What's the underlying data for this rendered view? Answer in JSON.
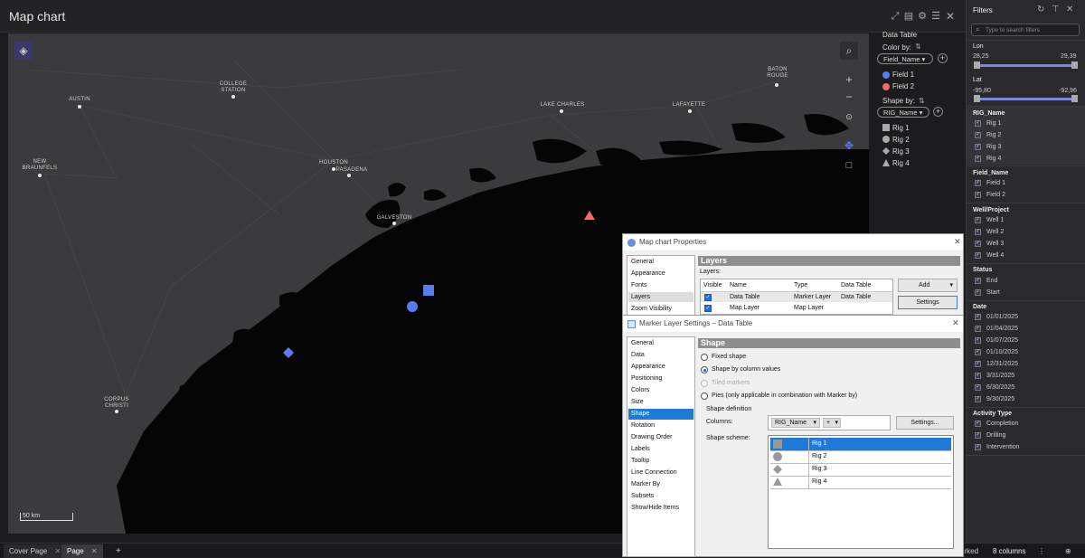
{
  "window": {
    "title": "Map chart"
  },
  "map": {
    "scale_label": "50 km",
    "cities": [
      {
        "name": "COLLEGE\nSTATION"
      },
      {
        "name": "AUSTIN"
      },
      {
        "name": "NEW\nBRAUNFELS"
      },
      {
        "name": "HOUSTON"
      },
      {
        "name": "PASADENA"
      },
      {
        "name": "GALVESTON"
      },
      {
        "name": "LAKE CHARLES"
      },
      {
        "name": "LAFAYETTE"
      },
      {
        "name": "BATON\nROUGE"
      },
      {
        "name": "CORPUS\nCHRISTI"
      }
    ],
    "markers": [
      {
        "field": "Field 2",
        "rig": "Rig 4",
        "color": "#f07060"
      },
      {
        "field": "Field 1",
        "rig": "Rig 1",
        "color": "#5b7cf0"
      },
      {
        "field": "Field 1",
        "rig": "Rig 2",
        "color": "#5b7cf0"
      },
      {
        "field": "Field 1",
        "rig": "Rig 3",
        "color": "#5b7cf0"
      }
    ]
  },
  "legend": {
    "title": "Data Table",
    "color_by_label": "Color by:",
    "color_by_value": "Field_Name",
    "color_items": [
      {
        "label": "Field 1",
        "color": "#5b7cf0"
      },
      {
        "label": "Field 2",
        "color": "#f07060"
      }
    ],
    "shape_by_label": "Shape by:",
    "shape_by_value": "RIG_Name",
    "shape_items": [
      {
        "label": "Rig 1",
        "shape": "square"
      },
      {
        "label": "Rig 2",
        "shape": "circle"
      },
      {
        "label": "Rig 3",
        "shape": "diamond"
      },
      {
        "label": "Rig 4",
        "shape": "triangle"
      }
    ]
  },
  "filters": {
    "title": "Filters",
    "search_placeholder": "Type to search filters",
    "lon": {
      "label": "Lon",
      "min": "28,25",
      "max": "29,39"
    },
    "lat": {
      "label": "Lat",
      "min": "-95,80",
      "max": "-92,96"
    },
    "rig_name": {
      "label": "RIG_Name",
      "items": [
        "Rig 1",
        "Rig 2",
        "Rig 3",
        "Rig 4"
      ]
    },
    "field_name": {
      "label": "Field_Name",
      "items": [
        "Field 1",
        "Field 2"
      ]
    },
    "well_project": {
      "label": "Well/Project",
      "items": [
        "Well 1",
        "Well 2",
        "Well 3",
        "Well 4"
      ]
    },
    "status": {
      "label": "Status",
      "items": [
        "End",
        "Start"
      ]
    },
    "date": {
      "label": "Date",
      "items": [
        "01/01/2025",
        "01/04/2025",
        "01/07/2025",
        "01/10/2025",
        "12/31/2025",
        "3/31/2025",
        "6/30/2025",
        "9/30/2025"
      ]
    },
    "activity_type": {
      "label": "Activity Type",
      "items": [
        "Completion",
        "Drilling",
        "Intervention"
      ]
    }
  },
  "bottom": {
    "tabs": [
      "Cover Page",
      "Page"
    ],
    "add": "+",
    "marked": "arked",
    "columns": "8 columns"
  },
  "props_dialog": {
    "title": "Map chart Properties",
    "nav": [
      "General",
      "Appearance",
      "Fonts",
      "Layers",
      "Zoom Visibility"
    ],
    "section": "Layers",
    "layers_label": "Layers:",
    "columns": [
      "Visible",
      "Name",
      "Type",
      "Data Table"
    ],
    "rows": [
      {
        "name": "Data Table",
        "type": "Marker Layer",
        "table": "Data Table"
      },
      {
        "name": "Map Layer",
        "type": "Map Layer",
        "table": ""
      }
    ],
    "add_label": "Add",
    "settings_label": "Settings"
  },
  "marker_dialog": {
    "title": "Marker Layer Settings – Data Table",
    "nav": [
      "General",
      "Data",
      "Appearance",
      "Positioning",
      "Colors",
      "Size",
      "Shape",
      "Rotation",
      "Drawing Order",
      "Labels",
      "Tooltip",
      "Line Connection",
      "Marker By",
      "Subsets",
      "Show/Hide Items"
    ],
    "selected_nav": "Shape",
    "section": "Shape",
    "options": {
      "fixed": "Fixed shape",
      "by_column": "Shape by column values",
      "tiled": "Tiled markers",
      "pies": "Pies (only applicable in combination with Marker by)"
    },
    "shape_definition": "Shape definition",
    "columns_label": "Columns:",
    "column_value": "RIG_Name",
    "plus": "+",
    "settings_label": "Settings...",
    "scheme_label": "Shape scheme:",
    "scheme": [
      {
        "label": "Rig 1",
        "shape": "square"
      },
      {
        "label": "Rig 2",
        "shape": "circle"
      },
      {
        "label": "Rig 3",
        "shape": "diamond"
      },
      {
        "label": "Rig 4",
        "shape": "triangle"
      }
    ]
  }
}
